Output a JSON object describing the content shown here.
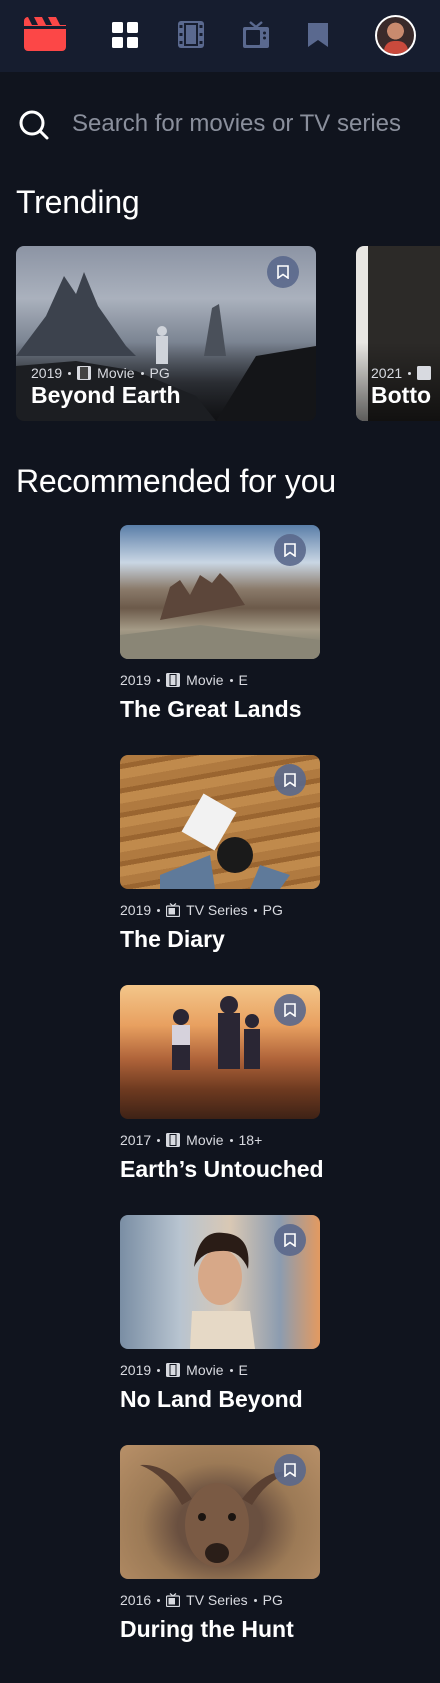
{
  "nav": {
    "logo_icon": "clapperboard-icon",
    "items": [
      {
        "name": "home",
        "icon": "grid-icon",
        "active": true
      },
      {
        "name": "movies",
        "icon": "film-icon",
        "active": false
      },
      {
        "name": "tv",
        "icon": "tv-icon",
        "active": false
      },
      {
        "name": "bookmarks",
        "icon": "bookmark-icon",
        "active": false
      }
    ],
    "avatar": "avatar"
  },
  "search": {
    "placeholder": "Search for movies or TV series",
    "value": ""
  },
  "trending": {
    "title": "Trending",
    "items": [
      {
        "year": "2019",
        "category": "Movie",
        "rating": "PG",
        "title": "Beyond Earth"
      },
      {
        "year": "2021",
        "category": "",
        "rating": "",
        "title": "Botto"
      }
    ]
  },
  "recommended": {
    "title": "Recommended for you",
    "items": [
      {
        "year": "2019",
        "category": "Movie",
        "rating": "E",
        "title": "The Great Lands"
      },
      {
        "year": "2019",
        "category": "TV Series",
        "rating": "PG",
        "title": "The Diary"
      },
      {
        "year": "2017",
        "category": "Movie",
        "rating": "18+",
        "title": "Earth’s Untouched"
      },
      {
        "year": "2019",
        "category": "Movie",
        "rating": "E",
        "title": "No Land Beyond"
      },
      {
        "year": "2016",
        "category": "TV Series",
        "rating": "PG",
        "title": "During the Hunt"
      }
    ]
  },
  "colors": {
    "background": "#10141e",
    "navbar": "#161d2f",
    "accent": "#fc4747",
    "nav_inactive": "#5a698f",
    "bookmark_bg": "#5a698f"
  }
}
